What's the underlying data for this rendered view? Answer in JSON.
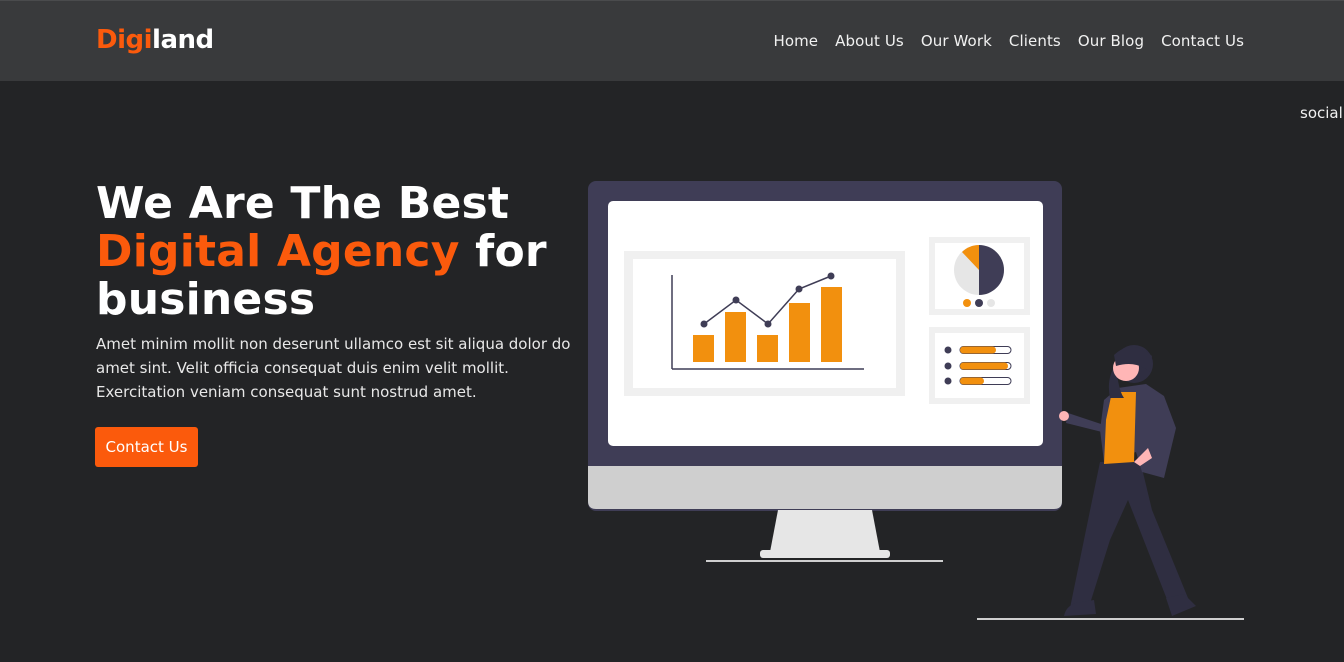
{
  "brand": {
    "part1": "Digi",
    "part2": "land"
  },
  "nav": {
    "items": [
      {
        "label": "Home"
      },
      {
        "label": "About Us"
      },
      {
        "label": "Our Work"
      },
      {
        "label": "Clients"
      },
      {
        "label": "Our Blog"
      },
      {
        "label": "Contact Us"
      }
    ]
  },
  "social_label": "social",
  "hero": {
    "title_line1": "We Are The Best",
    "title_highlight": "Digital Agency",
    "title_after": "for",
    "title_line3": "business",
    "description": "Amet minim mollit non deserunt ullamco est sit aliqua dolor do amet sint. Velit officia consequat duis enim velit mollit. Exercitation veniam consequat sunt nostrud amet.",
    "cta_label": "Contact Us"
  },
  "colors": {
    "accent": "#fb5a0c",
    "background": "#232426",
    "navbar": "#393a3c",
    "illustration_orange": "#f2900e",
    "illustration_dark": "#3f3d56"
  }
}
